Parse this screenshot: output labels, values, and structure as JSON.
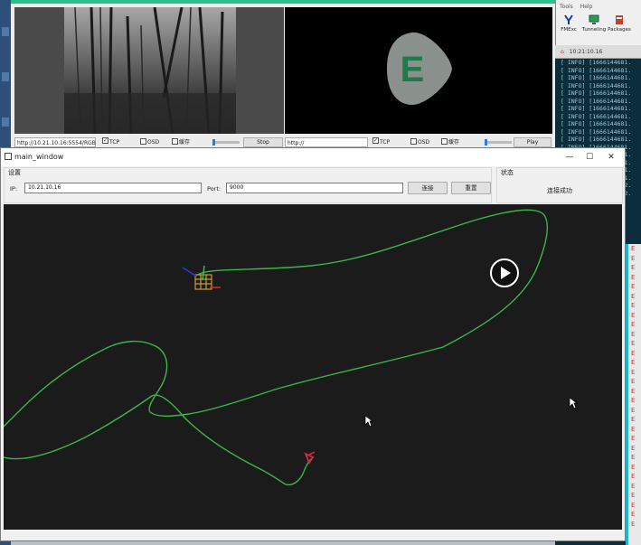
{
  "video_panel_a": {
    "url": "http://10.21.10.16:5554/RGB",
    "tcp_label": "TCP",
    "osd_label": "OSD",
    "cache_label": "缓存",
    "button": "Stop"
  },
  "video_panel_b": {
    "url": "http://",
    "tcp_label": "TCP",
    "osd_label": "OSD",
    "cache_label": "缓存",
    "button": "Play",
    "logo_letter": "E"
  },
  "ros_tools": {
    "menu": [
      "Tools",
      "Help"
    ],
    "items": [
      "FMExc",
      "Tunneling",
      "Packages"
    ],
    "time": "10:21:10.16"
  },
  "terminal": {
    "lines": [
      "[ INFO] [1666144681.",
      "[ INFO] [1666144681.",
      "[ INFO] [1666144681.",
      "[ INFO] [1666144681.",
      "[ INFO] [1666144681.",
      "[ INFO] [1666144681.",
      "[ INFO] [1666144681.",
      "[ INFO] [1666144681.",
      "[ INFO] [1666144681.",
      "[ INFO] [1666144681.",
      "[ INFO] [1666144681.",
      "[ INFO] [1666144681.",
      "[ INFO] [1666144681.",
      "[ INFO] [1666144681.",
      "[ INFO] [1666144681.",
      "[ INFO] [1666144681.",
      "[ INFO] [1666144682.",
      "[ INFO] [1666144682."
    ],
    "side_rows": [
      "E",
      "E",
      "E",
      "E",
      "E",
      "E",
      "E",
      "E",
      "E",
      "E",
      "E",
      "E",
      "E",
      "E",
      "E",
      "E",
      "E",
      "E",
      "E",
      "E",
      "E",
      "E",
      "E",
      "E",
      "E",
      "E",
      "E",
      "E",
      "E",
      "E"
    ]
  },
  "main_window": {
    "title": "main_window",
    "minimize": "—",
    "maximize": "☐",
    "close": "✕",
    "settings_group": "设置",
    "ip_label": "IP:",
    "ip_value": "10.21.10.16",
    "port_label": "Port:",
    "port_value": "9000",
    "connect_button": "连接",
    "reset_button": "重置",
    "status_group": "状态",
    "status_text": "连接成功"
  },
  "colors": {
    "path": "#3bb54a",
    "accent": "#27c08e",
    "canvas": "#1b1b1b"
  }
}
